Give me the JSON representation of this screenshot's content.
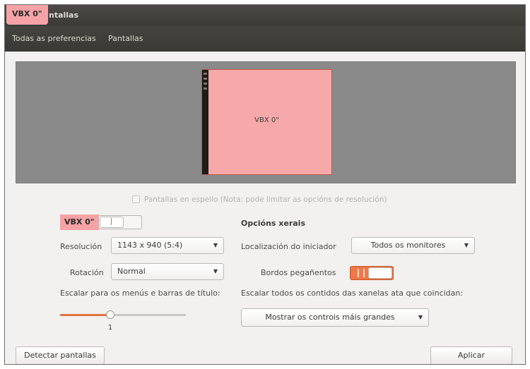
{
  "window": {
    "title_badge": "VBX 0\"",
    "title_text": "ntallas"
  },
  "breadcrumb": {
    "all_settings": "Todas as preferencias",
    "current": "Pantallas"
  },
  "arrangement": {
    "monitor_label": "VBX 0\""
  },
  "mirror": {
    "label": "Pantallas en espello (Nota: pode limitar as opcións de resolución)",
    "checked": false,
    "enabled": false
  },
  "display": {
    "name": "VBX 0\"",
    "enabled": false,
    "resolution_label": "Resolución",
    "resolution_value": "1143 x 940 (5:4)",
    "rotation_label": "Rotación",
    "rotation_value": "Normal",
    "scale_label": "Escalar para os menús e barras de título:",
    "scale_value": "1",
    "scale_fraction": 0.4
  },
  "general": {
    "heading": "Opcións xerais",
    "launcher_label": "Localización do iniciador",
    "launcher_value": "Todos os monitores",
    "sticky_edges_label": "Bordos pegañentos",
    "sticky_edges_on": true,
    "scale_all_label": "Escalar todos os contidos das xanelas ata que coincidan:",
    "scale_all_value": "Mostrar os controis máis grandes"
  },
  "buttons": {
    "detect": "Detectar pantallas",
    "apply": "Aplicar"
  },
  "colors": {
    "monitor_fill": "#f7a8a8",
    "accent": "#f07746"
  }
}
